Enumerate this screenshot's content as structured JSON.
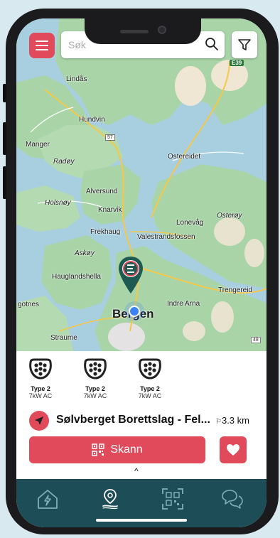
{
  "search": {
    "placeholder": "Søk"
  },
  "map": {
    "road_badges": {
      "e39": "E39",
      "r48": "48",
      "r57": "57"
    },
    "places": [
      {
        "id": "lindas",
        "label": "Lindås",
        "italic": false
      },
      {
        "id": "hundvin",
        "label": "Hundvin",
        "italic": false
      },
      {
        "id": "manger",
        "label": "Manger",
        "italic": false
      },
      {
        "id": "radoy",
        "label": "Radøy",
        "italic": true
      },
      {
        "id": "ostereidet",
        "label": "Ostereidet",
        "italic": false
      },
      {
        "id": "alversund",
        "label": "Alversund",
        "italic": false
      },
      {
        "id": "holsnoy",
        "label": "Holsnøy",
        "italic": true
      },
      {
        "id": "knarvik",
        "label": "Knarvik",
        "italic": false
      },
      {
        "id": "osteroy",
        "label": "Osterøy",
        "italic": true
      },
      {
        "id": "lonevag",
        "label": "Lonevåg",
        "italic": false
      },
      {
        "id": "frekhaug",
        "label": "Frekhaug",
        "italic": false
      },
      {
        "id": "valestrandsfossen",
        "label": "Valestrandsfossen",
        "italic": false
      },
      {
        "id": "askoy",
        "label": "Askøy",
        "italic": true
      },
      {
        "id": "hauglandshella",
        "label": "Hauglandshella",
        "italic": false
      },
      {
        "id": "trengereid",
        "label": "Trengereid",
        "italic": false
      },
      {
        "id": "gotnes",
        "label": "gotnes",
        "italic": false
      },
      {
        "id": "indre-arna",
        "label": "Indre Arna",
        "italic": false
      },
      {
        "id": "bergen",
        "label": "Bergen",
        "italic": false
      },
      {
        "id": "straume",
        "label": "Straume",
        "italic": false
      }
    ]
  },
  "connectors": [
    {
      "type": "Type 2",
      "power": "7kW AC"
    },
    {
      "type": "Type 2",
      "power": "7kW AC"
    },
    {
      "type": "Type 2",
      "power": "7kW AC"
    }
  ],
  "station": {
    "name": "Sølvberget Borettslag - Fel...",
    "distance": "3.3 km"
  },
  "actions": {
    "scan_label": "Skann"
  },
  "colors": {
    "accent": "#e14a5a",
    "tabbar": "#1d4d57",
    "marker": "#1e5a52"
  }
}
